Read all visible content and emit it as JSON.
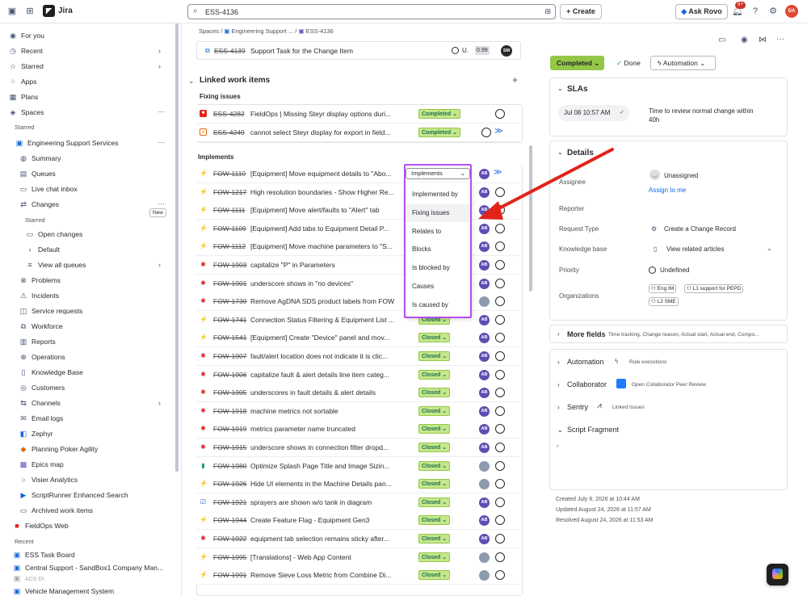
{
  "topbar": {
    "app_name": "Jira",
    "search_value": "ESS-4136",
    "create_label": "+ Create",
    "rovo_label": "Ask Rovo",
    "notif_count": "9+",
    "user_initials": "DA"
  },
  "sidebar": {
    "items": [
      {
        "label": "For you",
        "icon": "user-circle-icon"
      },
      {
        "label": "Recent",
        "icon": "clock-icon"
      },
      {
        "label": "Starred",
        "icon": "star-icon"
      },
      {
        "label": "Apps",
        "icon": "apps-icon"
      },
      {
        "label": "Plans",
        "icon": "plans-icon"
      },
      {
        "label": "Spaces",
        "icon": "spaces-icon"
      }
    ],
    "starred_heading": "Starred",
    "project": "Engineering Support Services",
    "project_items": [
      {
        "label": "Summary"
      },
      {
        "label": "Queues"
      },
      {
        "label": "Live chat inbox",
        "badge": "New"
      },
      {
        "label": "Changes"
      }
    ],
    "changes_starred_heading": "Starred",
    "change_items": [
      {
        "label": "Open changes"
      },
      {
        "label": "Default"
      },
      {
        "label": "View all queues"
      }
    ],
    "more_items": [
      {
        "label": "Problems"
      },
      {
        "label": "Incidents"
      },
      {
        "label": "Service requests"
      },
      {
        "label": "Workforce"
      },
      {
        "label": "Reports"
      },
      {
        "label": "Operations"
      },
      {
        "label": "Knowledge Base"
      },
      {
        "label": "Customers"
      },
      {
        "label": "Channels"
      },
      {
        "label": "Email logs"
      },
      {
        "label": "Zephyr"
      },
      {
        "label": "Planning Poker Agility"
      },
      {
        "label": "Epics map"
      },
      {
        "label": "Visier Analytics"
      },
      {
        "label": "ScriptRunner Enhanced Search"
      },
      {
        "label": "Archived work items"
      },
      {
        "label": "FieldOps Web"
      }
    ],
    "recent_heading": "Recent",
    "recent_items": [
      {
        "label": "ESS Task Board"
      },
      {
        "label": "Central Support - SandBox1 Company Man..."
      },
      {
        "label": "ADS DI"
      },
      {
        "label": "Vehicle Management System"
      }
    ]
  },
  "breadcrumb": {
    "spaces": "Spaces",
    "project": "Engineering Support ...",
    "issue": "ESS-4136"
  },
  "top_linked": {
    "key": "ESS-4139",
    "summary": "Support Task for the Change Item",
    "status": "U.",
    "score": "0.99",
    "avatar": "SM"
  },
  "linked": {
    "title": "Linked work items",
    "fixing_title": "Fixing issues",
    "fixing_rows": [
      {
        "key": "ESS-4282",
        "summary": "FieldOps | Missing Steyr display options duri...",
        "status": "Completed"
      },
      {
        "key": "ESS-4249",
        "summary": "cannot select Steyr display for export in field...",
        "status": "Completed"
      }
    ],
    "implements_title": "Implements",
    "implements_rows": [
      {
        "key": "FOW-1110",
        "summary": "[Equipment] Move equipment details to \"Abo...",
        "status": "",
        "av": "AB",
        "type": "story"
      },
      {
        "key": "FOW-1217",
        "summary": "High resolution boundaries - Show Higher Re...",
        "status": "",
        "av": "AB",
        "type": "story"
      },
      {
        "key": "FOW-1111",
        "summary": "[Equipment] Move alert/faults to \"Alert\" tab",
        "status": "",
        "av": "AB",
        "type": "story"
      },
      {
        "key": "FOW-1109",
        "summary": "[Equipment] Add tabs to Equipment Detail P...",
        "status": "",
        "av": "AB",
        "type": "story"
      },
      {
        "key": "FOW-1112",
        "summary": "[Equipment] Move machine parameters to \"S...",
        "status": "",
        "av": "AB",
        "type": "story"
      },
      {
        "key": "FOW-1903",
        "summary": "capitalize \"P\" in Parameters",
        "status": "",
        "av": "AB",
        "type": "bug"
      },
      {
        "key": "FOW-1901",
        "summary": "underscore shows in \"no devices\"",
        "status": "",
        "av": "AB",
        "type": "bug"
      },
      {
        "key": "FOW-1730",
        "summary": "Remove AgDNA SDS product labels from FOW",
        "status": "",
        "av": "",
        "type": "bug"
      },
      {
        "key": "FOW-1741",
        "summary": "Connection Status Filtering & Equipment List ...",
        "status": "Closed",
        "av": "AB",
        "type": "story"
      },
      {
        "key": "FOW-1541",
        "summary": "[Equipment] Create \"Device\" panel and mov...",
        "status": "Closed",
        "av": "AB",
        "type": "story"
      },
      {
        "key": "FOW-1907",
        "summary": "fault/alert location does not indicate it is clic...",
        "status": "Closed",
        "av": "AB",
        "type": "bug"
      },
      {
        "key": "FOW-1906",
        "summary": "capitalize fault & alert details line item categ...",
        "status": "Closed",
        "av": "AB",
        "type": "bug"
      },
      {
        "key": "FOW-1905",
        "summary": "underscores in fault details & alert details",
        "status": "Closed",
        "av": "AB",
        "type": "bug"
      },
      {
        "key": "FOW-1918",
        "summary": "machine metrics not sortable",
        "status": "Closed",
        "av": "AB",
        "type": "bug"
      },
      {
        "key": "FOW-1919",
        "summary": "metrics parameter name truncated",
        "status": "Closed",
        "av": "AB",
        "type": "bug"
      },
      {
        "key": "FOW-1915",
        "summary": "underscore shows in connection filter dropd...",
        "status": "Closed",
        "av": "AB",
        "type": "bug"
      },
      {
        "key": "FOW-1980",
        "summary": "Optimize Splash Page Title and Image Sizin...",
        "status": "Closed",
        "av": "",
        "type": "bookmark"
      },
      {
        "key": "FOW-1926",
        "summary": "Hide UI elements in the Machine Details pan...",
        "status": "Closed",
        "av": "",
        "type": "story"
      },
      {
        "key": "FOW-1921",
        "summary": "sprayers are shown w/o tank in diagram",
        "status": "Closed",
        "av": "AB",
        "type": "task"
      },
      {
        "key": "FOW-1944",
        "summary": "Create Feature Flag - Equipment Gen3",
        "status": "Closed",
        "av": "AB",
        "type": "story"
      },
      {
        "key": "FOW-1922",
        "summary": "equipment tab selection remains sticky after...",
        "status": "Closed",
        "av": "AB",
        "type": "bug"
      },
      {
        "key": "FOW-1995",
        "summary": "[Translations] - Web App Content",
        "status": "Closed",
        "av": "",
        "type": "story"
      },
      {
        "key": "FOW-1991",
        "summary": "Remove Sieve Loss Metric from Combine Di...",
        "status": "Closed",
        "av": "",
        "type": "story"
      }
    ]
  },
  "link_dropdown": {
    "selected": "Implements",
    "options": [
      "Implemented by",
      "Fixing issues",
      "Relates to",
      "Blocks",
      "Is blocked by",
      "Causes",
      "Is caused by"
    ]
  },
  "right": {
    "status": "Completed",
    "done": "Done",
    "automation": "Automation",
    "slas_title": "SLAs",
    "sla_time": "Jul 08 10:57 AM",
    "sla_desc": "Time to review normal change within 40h",
    "details_title": "Details",
    "fields": {
      "assignee_label": "Assignee",
      "assignee_value": "Unassigned",
      "assign_to_me": "Assign to me",
      "reporter_label": "Reporter",
      "request_type_label": "Request Type",
      "request_type_value": "Create a Change Record",
      "kb_label": "Knowledge base",
      "kb_value": "View related articles",
      "priority_label": "Priority",
      "priority_value": "Undefined",
      "org_label": "Organizations",
      "orgs": [
        "Eng IM",
        "L1 support for PEPD",
        "L2 SME"
      ]
    },
    "more_fields": "More fields",
    "more_fields_hint": "Time tracking, Change reason, Actual start, Actual end, Compo...",
    "automation_section": "Automation",
    "automation_hint": "Rule executions",
    "collaborator": "Collaborator",
    "collaborator_hint": "Open Collaborator Peer Review",
    "sentry": "Sentry",
    "sentry_hint": "Linked Issues",
    "script_fragment": "Script Fragment",
    "created": "Created July 8, 2026 at 10:44 AM",
    "updated": "Updated August 24, 2026 at 11:57 AM",
    "resolved": "Resolved August 24, 2026 at 11:53 AM"
  },
  "colors": {
    "accent": "#0c66e4",
    "status_green": "#94c748",
    "highlight": "#b54ff0",
    "arrow": "#e2231a"
  }
}
